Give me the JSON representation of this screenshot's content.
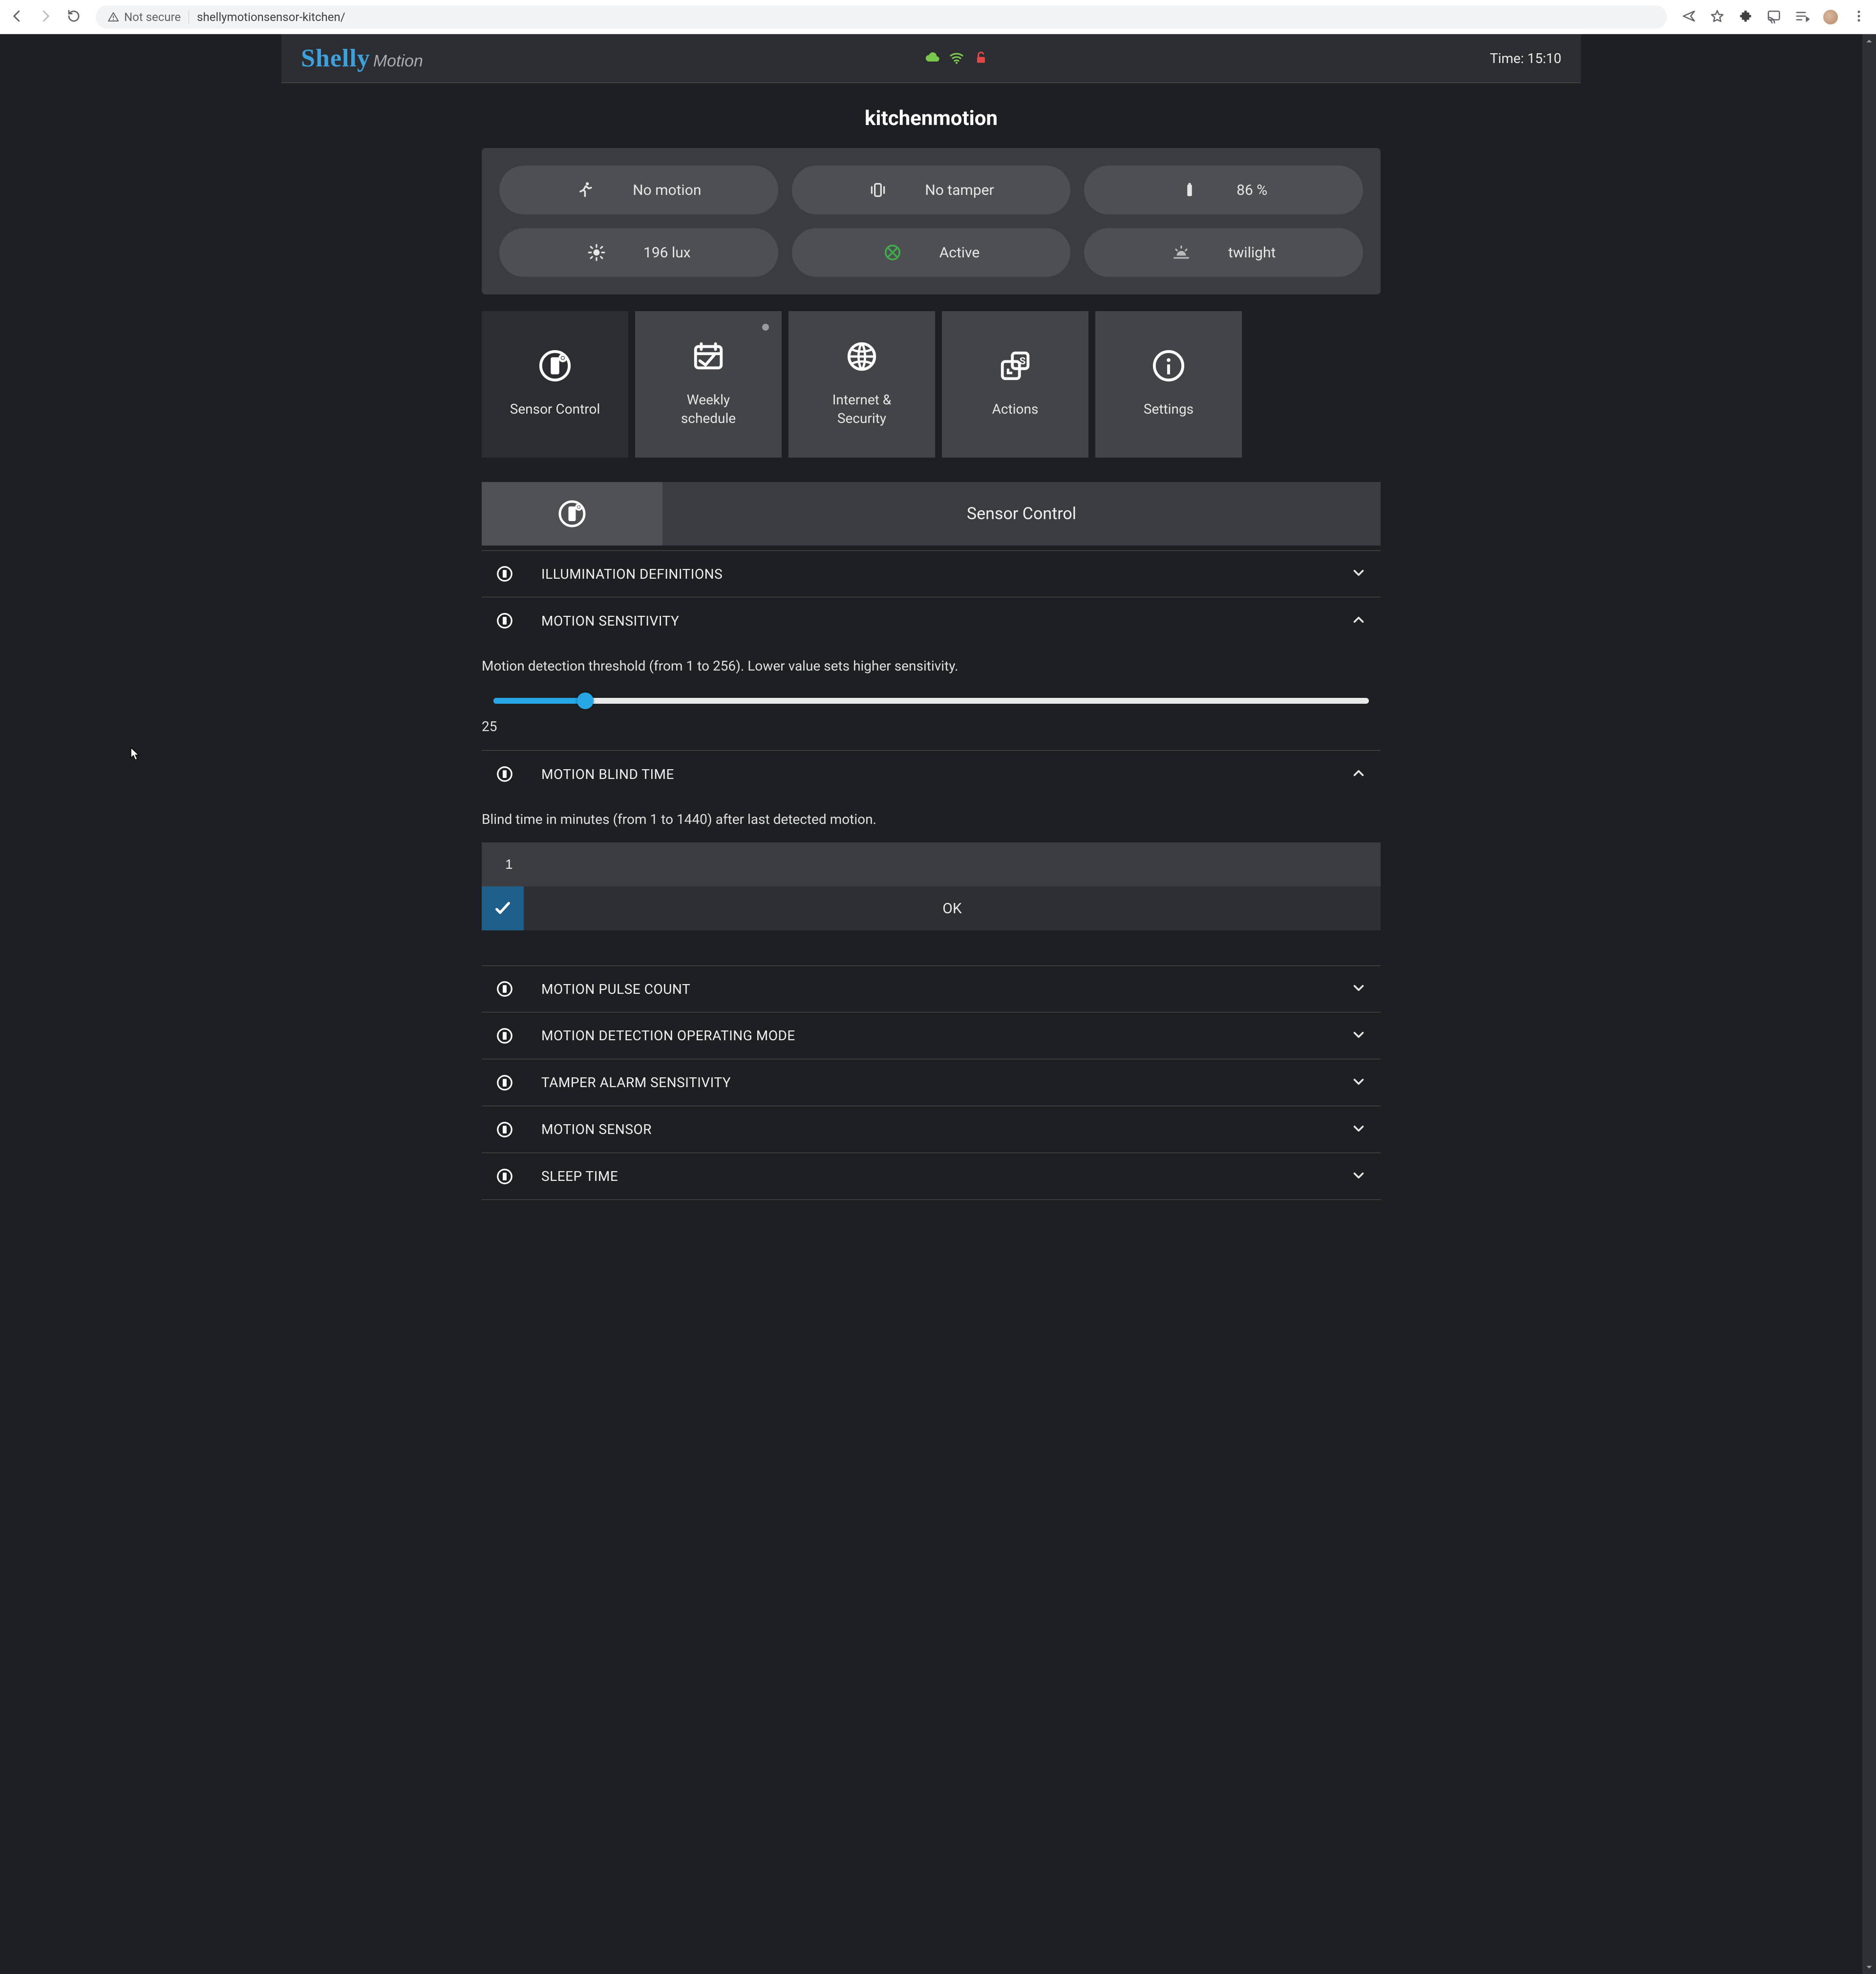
{
  "browser": {
    "security_label": "Not secure",
    "url": "shellymotionsensor-kitchen/"
  },
  "header": {
    "logo_primary": "Shelly",
    "logo_secondary": "Motion",
    "time_label": "Time: 15:10",
    "cloud_color": "#79c84d",
    "wifi_color": "#79c84d",
    "lock_color": "#e04848"
  },
  "device_title": "kitchenmotion",
  "status": {
    "motion": "No motion",
    "tamper": "No tamper",
    "battery": "86 %",
    "lux": "196 lux",
    "active": "Active",
    "twilight": "twilight",
    "active_color": "#3fae49"
  },
  "tiles": [
    {
      "label": "Sensor Control"
    },
    {
      "label": "Weekly\nschedule"
    },
    {
      "label": "Internet &\nSecurity"
    },
    {
      "label": "Actions"
    },
    {
      "label": "Settings"
    }
  ],
  "section_title": "Sensor Control",
  "accordion": {
    "illumination": "ILLUMINATION DEFINITIONS",
    "motion_sensitivity": "MOTION SENSITIVITY",
    "sensitivity_desc": "Motion detection threshold (from 1 to 256). Lower value sets higher sensitivity.",
    "sensitivity_value": "25",
    "blind_time": "MOTION BLIND TIME",
    "blind_desc": "Blind time in minutes (from 1 to 1440) after last detected motion.",
    "blind_value": "1",
    "ok_label": "OK",
    "pulse_count": "MOTION PULSE COUNT",
    "operating_mode": "MOTION DETECTION OPERATING MODE",
    "tamper_sensitivity": "TAMPER ALARM SENSITIVITY",
    "motion_sensor": "MOTION SENSOR",
    "sleep_time": "SLEEP TIME"
  }
}
